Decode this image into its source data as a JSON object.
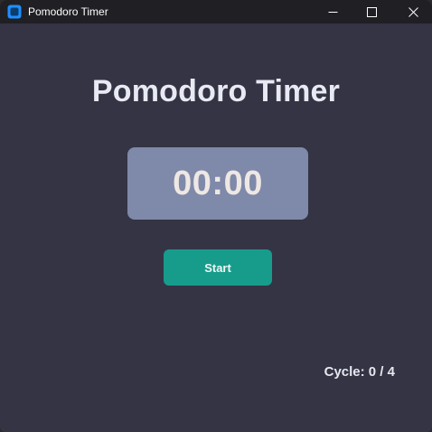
{
  "window": {
    "title": "Pomodoro Timer",
    "icon": "app-window-icon",
    "controls": {
      "minimize_icon": "minimize-icon",
      "maximize_icon": "maximize-icon",
      "close_icon": "close-icon"
    }
  },
  "main": {
    "heading": "Pomodoro Timer",
    "timer_display": "00:00",
    "start_label": "Start",
    "cycle_text": "Cycle: 0 / 4"
  },
  "colors": {
    "background": "#343445",
    "titlebar": "#1f1f24",
    "timer_box": "#7f89a9",
    "start_button": "#179c8c",
    "heading_text": "#e8eaf3",
    "app_icon_accent": "#1e90ff"
  }
}
